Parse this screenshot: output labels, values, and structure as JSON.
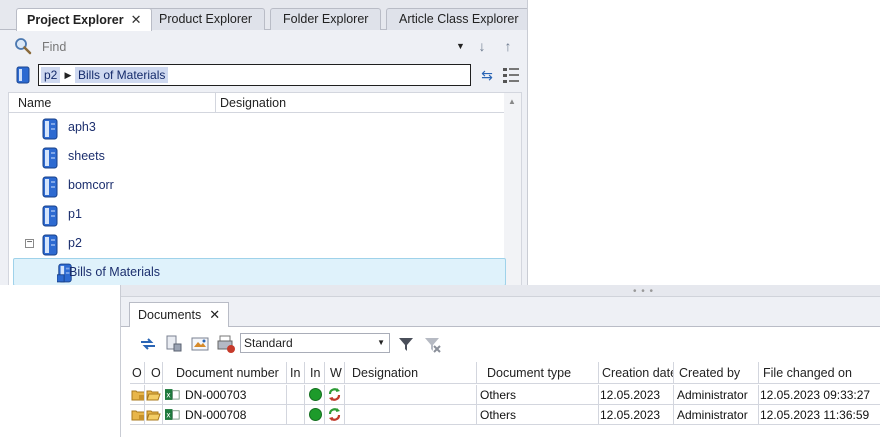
{
  "explorer": {
    "tabs": [
      {
        "label": "Project Explorer",
        "active": true,
        "close": "✕"
      },
      {
        "label": "Product Explorer",
        "active": false
      },
      {
        "label": "Folder Explorer",
        "active": false
      },
      {
        "label": "Article Class Explorer",
        "active": false
      }
    ],
    "find": {
      "placeholder": "Find"
    },
    "path": {
      "root": "p2",
      "current": "Bills of Materials"
    },
    "columns": [
      "Name",
      "Designation"
    ],
    "tree": [
      {
        "name": "aph3",
        "level": 0
      },
      {
        "name": "sheets",
        "level": 0
      },
      {
        "name": "bomcorr",
        "level": 0
      },
      {
        "name": "p1",
        "level": 0
      },
      {
        "name": "p2",
        "level": 0,
        "expanded": true,
        "expander": "−"
      },
      {
        "name": "Bills of Materials",
        "level": 1,
        "selected": true
      }
    ]
  },
  "documents": {
    "tab": {
      "label": "Documents",
      "close": "✕"
    },
    "view": "Standard",
    "columns": [
      "O",
      "O",
      "Document number",
      "In",
      "In",
      "W",
      "Designation",
      "Document type",
      "Creation date",
      "Created by",
      "File changed on"
    ],
    "rows": [
      {
        "number": "DN-000703",
        "designation": "",
        "type": "Others",
        "created": "12.05.2023",
        "created_by": "Administrator",
        "changed": "12.05.2023 09:33:27"
      },
      {
        "number": "DN-000708",
        "designation": "",
        "type": "Others",
        "created": "12.05.2023",
        "created_by": "Administrator",
        "changed": "12.05.2023 11:36:59"
      }
    ]
  },
  "colors": {
    "accent": "#2a65b5",
    "selection": "#dff2fb",
    "status_ok": "#1d9b2b"
  }
}
